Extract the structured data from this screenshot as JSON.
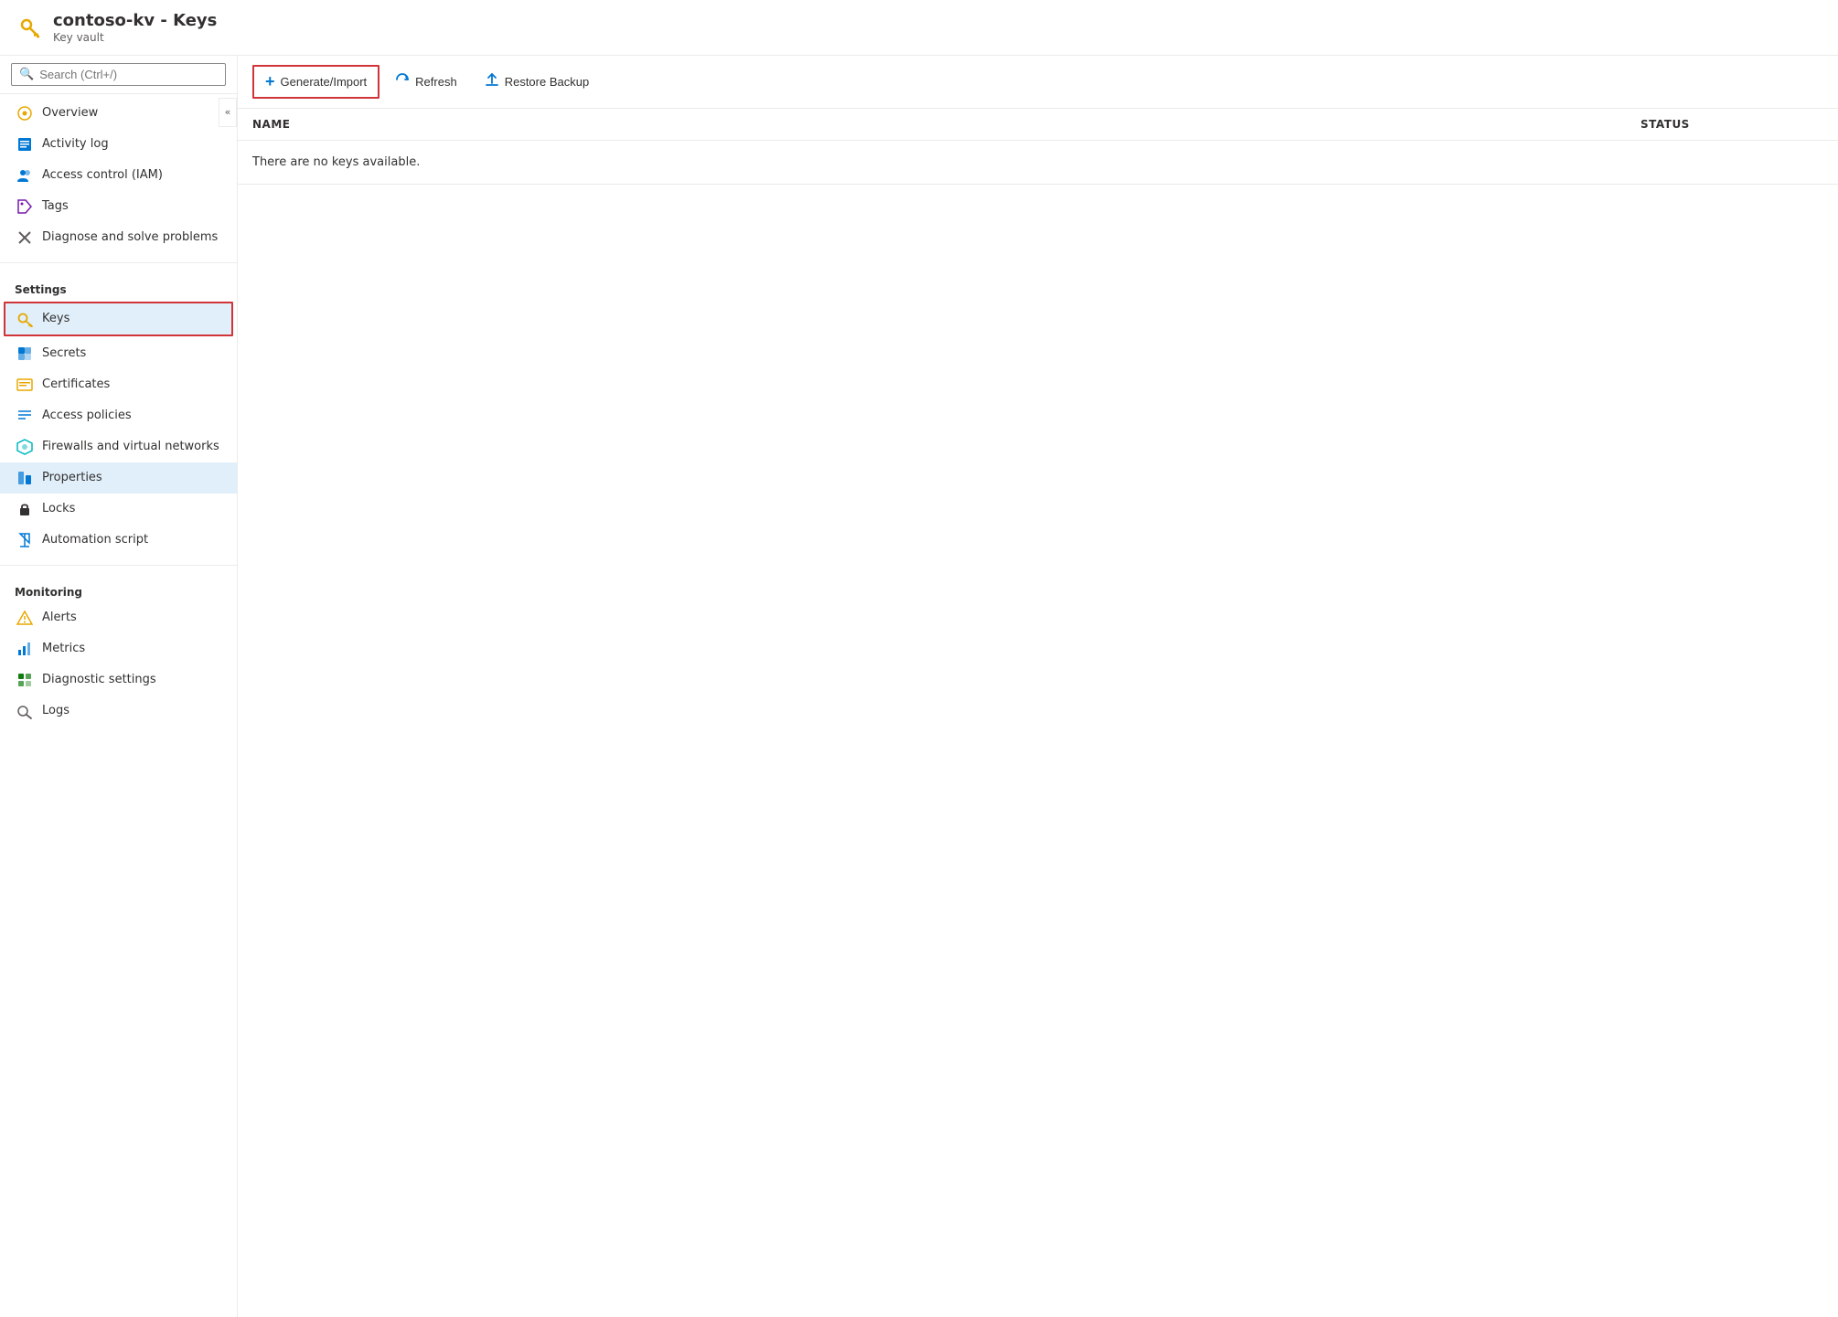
{
  "header": {
    "title": "contoso-kv - Keys",
    "subtitle": "Key vault",
    "icon_label": "key-vault-icon"
  },
  "search": {
    "placeholder": "Search (Ctrl+/)"
  },
  "nav": {
    "top_items": [
      {
        "id": "overview",
        "label": "Overview",
        "icon": "⊙",
        "icon_color": "orange"
      },
      {
        "id": "activity-log",
        "label": "Activity log",
        "icon": "▤",
        "icon_color": "blue"
      },
      {
        "id": "access-control",
        "label": "Access control (IAM)",
        "icon": "👥",
        "icon_color": "blue"
      },
      {
        "id": "tags",
        "label": "Tags",
        "icon": "🏷",
        "icon_color": "purple"
      },
      {
        "id": "diagnose",
        "label": "Diagnose and solve problems",
        "icon": "✕",
        "icon_color": "gray"
      }
    ],
    "settings_section": "Settings",
    "settings_items": [
      {
        "id": "keys",
        "label": "Keys",
        "icon": "🔑",
        "icon_color": "yellow",
        "active": true
      },
      {
        "id": "secrets",
        "label": "Secrets",
        "icon": "⊞",
        "icon_color": "blue"
      },
      {
        "id": "certificates",
        "label": "Certificates",
        "icon": "⊡",
        "icon_color": "yellow"
      },
      {
        "id": "access-policies",
        "label": "Access policies",
        "icon": "≡",
        "icon_color": "blue"
      },
      {
        "id": "firewalls",
        "label": "Firewalls and virtual networks",
        "icon": "⬡",
        "icon_color": "teal"
      },
      {
        "id": "properties",
        "label": "Properties",
        "icon": "▦",
        "icon_color": "blue",
        "highlight": true
      },
      {
        "id": "locks",
        "label": "Locks",
        "icon": "🔒",
        "icon_color": "gray"
      },
      {
        "id": "automation",
        "label": "Automation script",
        "icon": "⬇",
        "icon_color": "blue"
      }
    ],
    "monitoring_section": "Monitoring",
    "monitoring_items": [
      {
        "id": "alerts",
        "label": "Alerts",
        "icon": "⚡",
        "icon_color": "yellow"
      },
      {
        "id": "metrics",
        "label": "Metrics",
        "icon": "📊",
        "icon_color": "blue"
      },
      {
        "id": "diagnostic-settings",
        "label": "Diagnostic settings",
        "icon": "⊞",
        "icon_color": "green"
      },
      {
        "id": "logs",
        "label": "Logs",
        "icon": "🔍",
        "icon_color": "gray"
      }
    ]
  },
  "toolbar": {
    "generate_import_label": "Generate/Import",
    "refresh_label": "Refresh",
    "restore_backup_label": "Restore Backup"
  },
  "table": {
    "col_name": "NAME",
    "col_status": "STATUS",
    "empty_message": "There are no keys available."
  }
}
